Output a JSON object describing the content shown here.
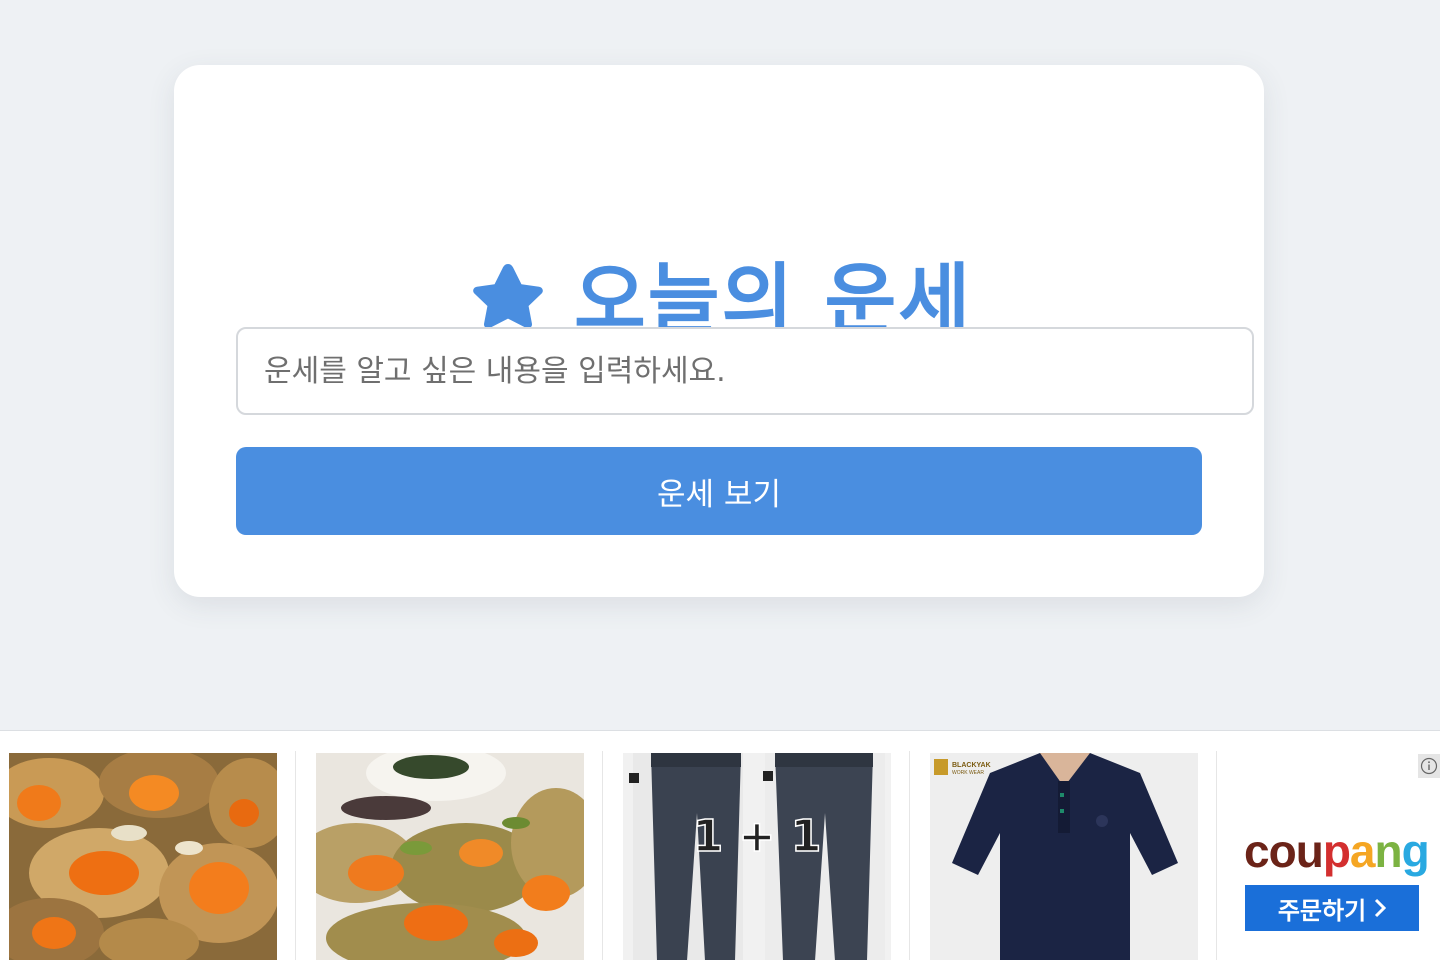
{
  "app": {
    "title": "오늘의 운세",
    "title_icon": "star-icon",
    "accent_color": "#4a8ee0"
  },
  "form": {
    "input_value": "",
    "input_placeholder": "운세를 알고 싶은 내용을 입력하세요.",
    "submit_label": "운세 보기"
  },
  "ad": {
    "products": [
      {
        "name": "marinated-crab-product",
        "icon": "crab-image"
      },
      {
        "name": "marinated-crab-dish-product",
        "icon": "crab-dish-image"
      },
      {
        "name": "pants-product",
        "icon": "pants-image",
        "overlay_text": "1+1"
      },
      {
        "name": "polo-shirt-product",
        "icon": "polo-shirt-image",
        "brand_text": "BLACKYAK"
      }
    ],
    "brand": "coupang",
    "brand_letters": [
      "c",
      "o",
      "u",
      "p",
      "a",
      "n",
      "g"
    ],
    "brand_colors": [
      "#6b2318",
      "#6b2318",
      "#6b2318",
      "#d32f2f",
      "#f5a623",
      "#7cb342",
      "#29a9e1"
    ],
    "order_label": "주문하기",
    "order_chevron": "chevron-right-icon",
    "info_icon": "info-icon"
  }
}
